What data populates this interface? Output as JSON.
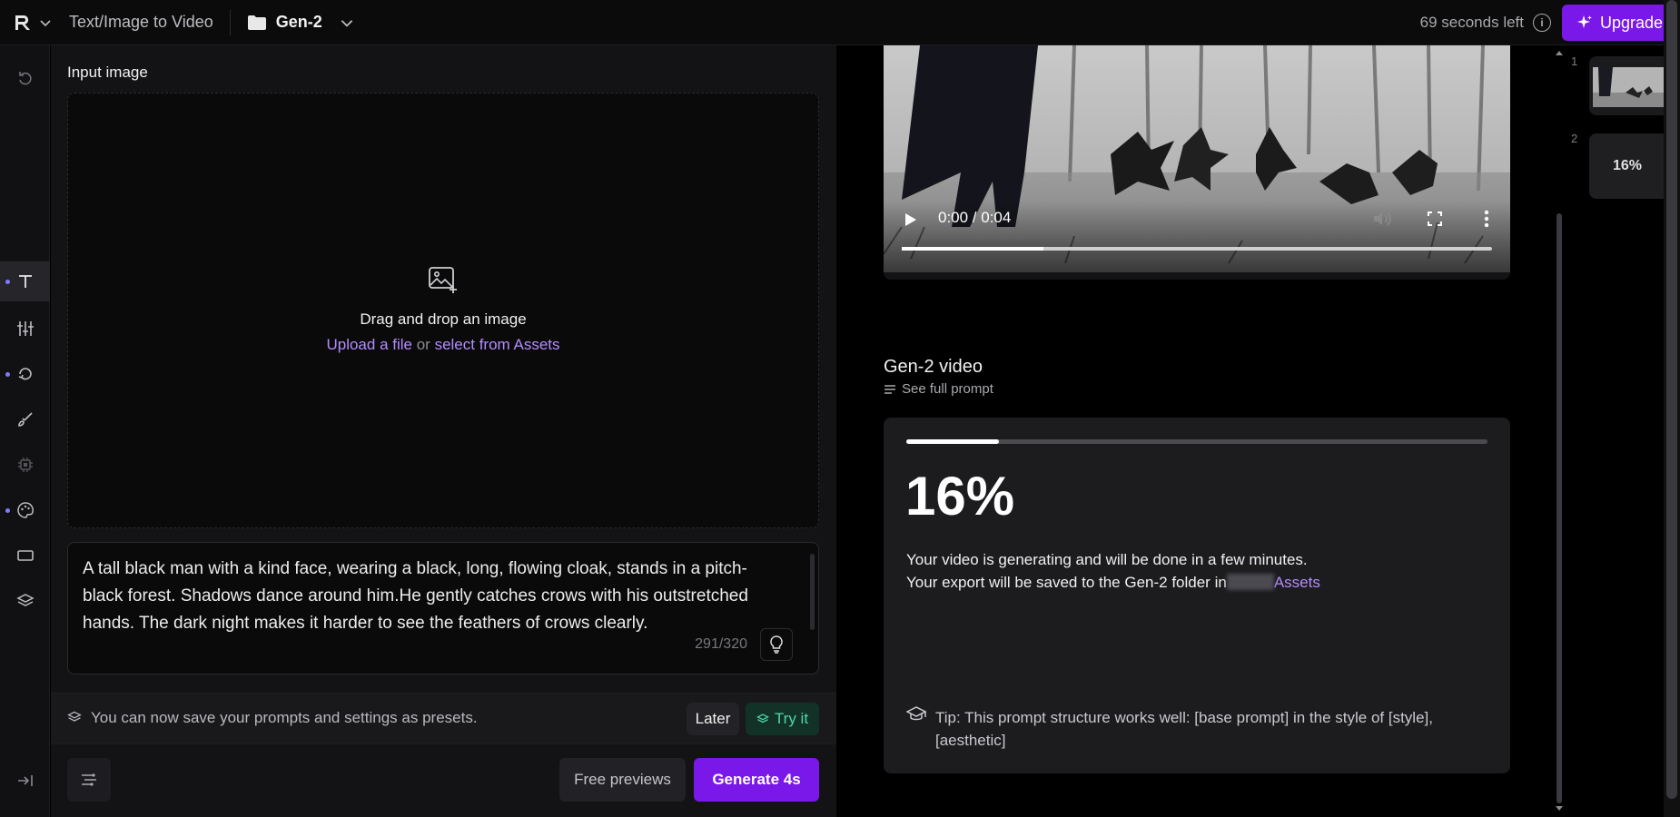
{
  "topbar": {
    "tool_name": "Text/Image to Video",
    "folder_name": "Gen-2",
    "seconds_left": "69 seconds left",
    "info_glyph": "i",
    "upgrade_label": "Upgrade"
  },
  "rail": {
    "icons": [
      "undo-icon",
      "text-icon",
      "sliders-icon",
      "camera-motion-icon",
      "brush-icon",
      "chip-icon",
      "palette-icon",
      "aspect-ratio-icon",
      "layers-icon",
      "collapse-icon"
    ]
  },
  "input": {
    "label": "Input image",
    "drop_title": "Drag and drop an image",
    "upload_link": "Upload a file",
    "or_text": "or",
    "assets_link": "select from Assets"
  },
  "prompt": {
    "text": "A tall black man with a kind face, wearing a black, long, flowing cloak, stands in a pitch-black forest. Shadows dance around him.He gently catches crows with his outstretched hands. The dark night makes it harder to see the feathers of crows clearly.",
    "counter": "291/320"
  },
  "presets": {
    "message": "You can now save your prompts and settings as presets.",
    "later_label": "Later",
    "try_label": "Try it"
  },
  "actions": {
    "free_previews": "Free previews",
    "generate": "Generate 4s"
  },
  "video": {
    "time": "0:00 / 0:04",
    "progress_fraction": 0.24
  },
  "job": {
    "title": "Gen-2 video",
    "see_prompt": "See full prompt",
    "progress_fraction": 0.16,
    "percent": "16%",
    "message_line1": "Your video is generating and will be done in a few minutes.",
    "message_line2_prefix": "Your export will be saved to the Gen-2 folder in",
    "assets_label": "Assets",
    "tip": "Tip: This prompt structure works well: [base prompt] in the style of [style], [aesthetic]"
  },
  "queue": {
    "item1_index": "1",
    "item2_index": "2",
    "item2_label": "16%"
  },
  "colors": {
    "accent": "#7a18ea",
    "link": "#b58cff",
    "success": "#4fd6a6"
  }
}
